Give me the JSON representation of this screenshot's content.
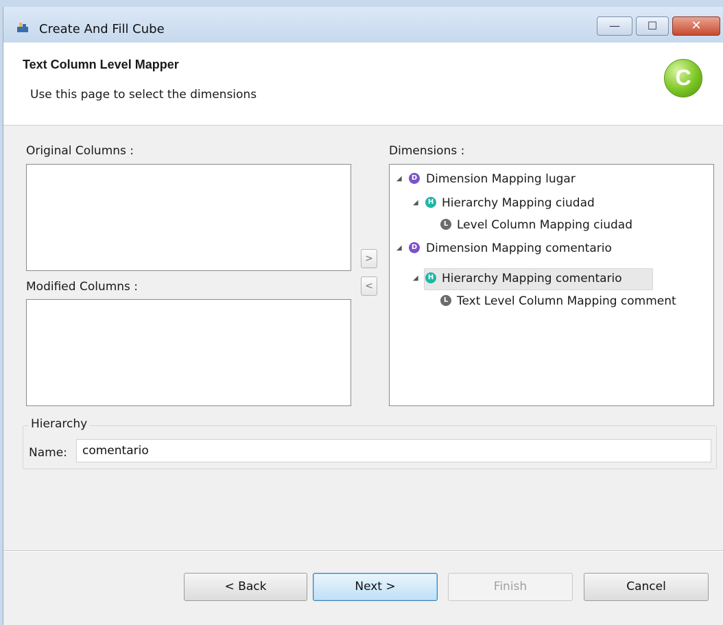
{
  "window": {
    "title": "Create And Fill Cube",
    "controls": {
      "minimize": "—",
      "maximize": "☐",
      "close": "✕"
    }
  },
  "header": {
    "title": "Text Column Level Mapper",
    "description": "Use this page to select the dimensions",
    "logo_letter": "C"
  },
  "left": {
    "original_label": "Original Columns :",
    "modified_label": "Modified Columns :"
  },
  "transfer": {
    "add": ">",
    "remove": "<"
  },
  "dimensions": {
    "label": "Dimensions :",
    "tree": [
      {
        "text": "Dimension Mapping lugar",
        "type": "D",
        "level": 0
      },
      {
        "text": "Hierarchy Mapping ciudad",
        "type": "H",
        "level": 1
      },
      {
        "text": "Level Column Mapping ciudad",
        "type": "L",
        "level": 2
      },
      {
        "text": "Dimension Mapping comentario",
        "type": "D",
        "level": 0
      },
      {
        "text": "Hierarchy Mapping comentario",
        "type": "H",
        "level": 1,
        "selected": true
      },
      {
        "text": "Text Level Column Mapping comment",
        "type": "L",
        "level": 2
      }
    ],
    "icon_letters": {
      "D": "D",
      "H": "H",
      "L": "L"
    }
  },
  "hierarchy": {
    "group_title": "Hierarchy",
    "name_label": "Name:",
    "name_value": "comentario"
  },
  "buttons": {
    "back": "< Back",
    "next": "Next >",
    "finish": "Finish",
    "cancel": "Cancel"
  },
  "colors": {
    "dimension_icon": "#7b53c9",
    "hierarchy_icon": "#1fb6a5",
    "level_icon": "#6b6b6b",
    "logo": "#7cc623"
  }
}
